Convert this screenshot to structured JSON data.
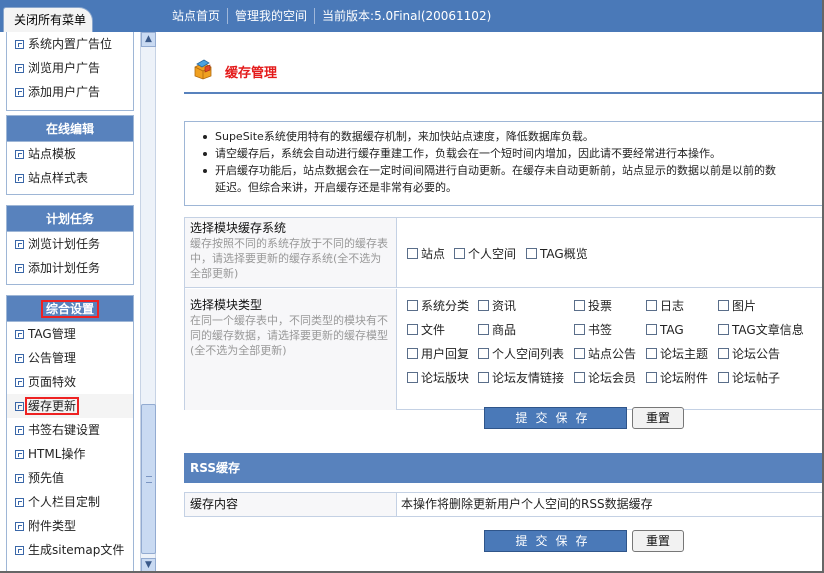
{
  "topbar": {
    "close_all_menu": "关闭所有菜单",
    "nav": [
      "站点首页",
      "管理我的空间",
      "当前版本:5.0Final(20061102)"
    ]
  },
  "sidebar": {
    "group1_items": [
      "系统内置广告位",
      "浏览用户广告",
      "添加用户广告"
    ],
    "group2": {
      "title": "在线编辑",
      "items": [
        "站点模板",
        "站点样式表"
      ]
    },
    "group3": {
      "title": "计划任务",
      "items": [
        "浏览计划任务",
        "添加计划任务"
      ]
    },
    "group4": {
      "title": "综合设置",
      "items": [
        "TAG管理",
        "公告管理",
        "页面特效",
        "缓存更新",
        "书签右键设置",
        "HTML操作",
        "预先值",
        "个人栏目定制",
        "附件类型",
        "生成sitemap文件"
      ]
    },
    "selected_item": "缓存更新"
  },
  "page": {
    "title": "缓存管理",
    "info_lines": [
      "SupeSite系统使用特有的数据缓存机制，来加快站点速度，降低数据库负载。",
      "请空缓存后，系统会自动进行缓存重建工作，负载会在一个短时间内增加，因此请不要经常进行本操作。",
      "开启缓存功能后，站点数据会在一定时间间隔进行自动更新。在缓存未自动更新前，站点显示的数据以前是以前的数",
      "延迟。但综合来讲，开启缓存还是非常有必要的。"
    ]
  },
  "form": {
    "row1": {
      "title": "选择模块缓存系统",
      "desc": "缓存按照不同的系统存放于不同的缓存表中，请选择要更新的缓存系统(全不选为全部更新)",
      "options": [
        "站点",
        "个人空间",
        "TAG概览"
      ]
    },
    "row2": {
      "title": "选择模块类型",
      "desc": "在同一个缓存表中，不同类型的模块有不同的缓存数据，请选择要更新的缓存模型(全不选为全部更新)",
      "options": [
        "系统分类",
        "资讯",
        "投票",
        "日志",
        "图片",
        "文件",
        "商品",
        "书签",
        "TAG",
        "TAG文章信息",
        "用户回复",
        "个人空间列表",
        "站点公告",
        "论坛主题",
        "论坛公告",
        "论坛版块",
        "论坛友情链接",
        "论坛会员",
        "论坛附件",
        "论坛帖子"
      ]
    },
    "submit_label": "提交保存",
    "reset_label": "重置"
  },
  "rss": {
    "title": "RSS缓存",
    "label": "缓存内容",
    "value": "本操作将删除更新用户个人空间的RSS数据缓存",
    "submit_label": "提交保存",
    "reset_label": "重置"
  }
}
